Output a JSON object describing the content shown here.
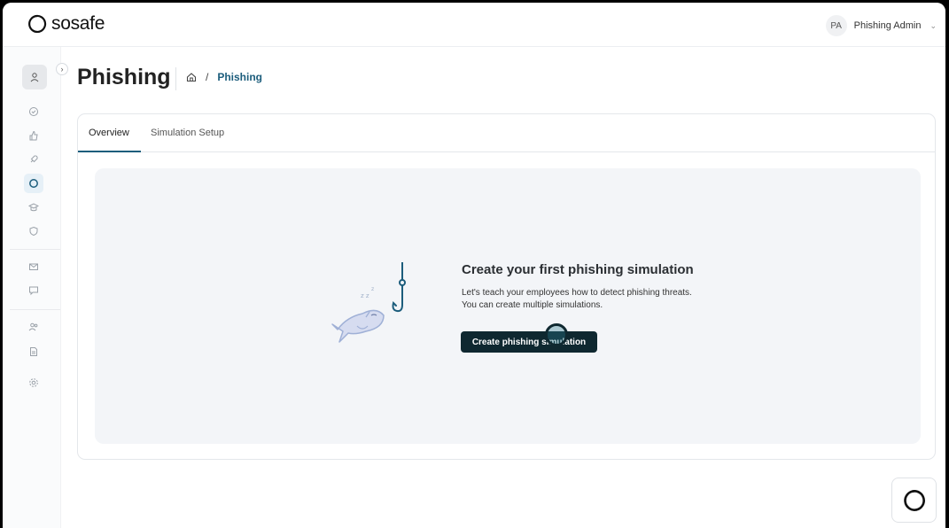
{
  "brand": {
    "name": "sosafe"
  },
  "user": {
    "initials": "PA",
    "name": "Phishing Admin"
  },
  "page": {
    "title": "Phishing"
  },
  "breadcrumb": {
    "separator": "/",
    "current": "Phishing"
  },
  "tabs": [
    {
      "label": "Overview",
      "active": true
    },
    {
      "label": "Simulation Setup",
      "active": false
    }
  ],
  "empty_state": {
    "title": "Create your first phishing simulation",
    "description_line1": "Let's teach your employees how to detect phishing threats.",
    "description_line2": "You can create multiple simulations.",
    "cta_label": "Create phishing simulation"
  },
  "sidebar": {
    "icons": [
      "check-circle-icon",
      "thumbs-up-icon",
      "rocket-icon",
      "phishing-icon",
      "graduation-cap-icon",
      "shield-icon",
      "mail-icon",
      "chat-icon",
      "users-icon",
      "document-icon",
      "settings-icon"
    ],
    "active": "phishing-icon"
  },
  "colors": {
    "accent": "#1c5d7c",
    "cta": "#0f2830",
    "panel": "#f3f5f8"
  }
}
